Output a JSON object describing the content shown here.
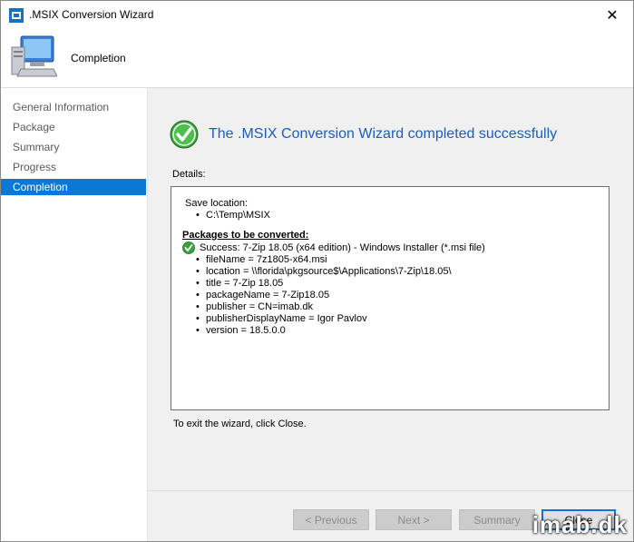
{
  "window": {
    "title": ".MSIX Conversion Wizard"
  },
  "header": {
    "title": "Completion"
  },
  "sidebar": {
    "items": [
      {
        "label": "General Information"
      },
      {
        "label": "Package"
      },
      {
        "label": "Summary"
      },
      {
        "label": "Progress"
      },
      {
        "label": "Completion",
        "active": true
      }
    ]
  },
  "main": {
    "success_message": "The .MSIX Conversion Wizard completed successfully",
    "details_label": "Details:",
    "details": {
      "save_location_label": "Save location:",
      "save_location": "C:\\Temp\\MSIX",
      "packages_heading": "Packages to be converted:",
      "success_line": "Success: 7-Zip 18.05 (x64 edition) - Windows Installer (*.msi file)",
      "properties": [
        "fileName = 7z1805-x64.msi",
        "location = \\\\florida\\pkgsource$\\Applications\\7-Zip\\18.05\\",
        "title = 7-Zip 18.05",
        "packageName = 7-Zip18.05",
        "publisher = CN=imab.dk",
        "publisherDisplayName = Igor Pavlov",
        "version = 18.5.0.0"
      ]
    },
    "exit_text": "To exit the wizard, click Close."
  },
  "buttons": {
    "previous": "< Previous",
    "next": "Next >",
    "summary": "Summary",
    "close": "Close"
  },
  "watermark": "imab.dk",
  "colors": {
    "accent": "#0a78d7",
    "success_text": "#1c5ebf",
    "success_green": "#3aa33a"
  }
}
